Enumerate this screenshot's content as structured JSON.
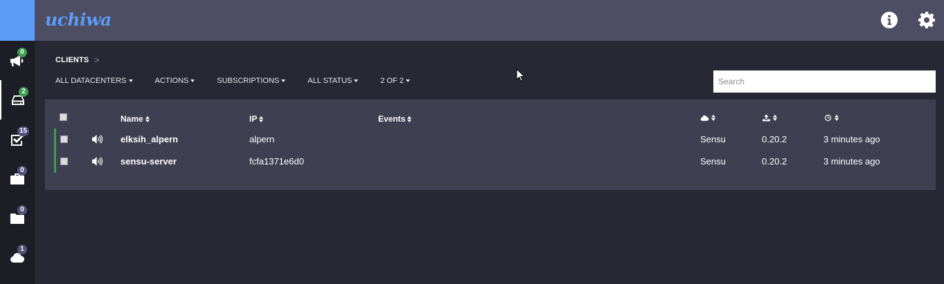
{
  "app": {
    "brand": "uchiwa"
  },
  "colors": {
    "accent": "#5c9bf7",
    "ok": "#3e9c52",
    "badge": "#54507a"
  },
  "sidebar": {
    "items": [
      {
        "icon": "megaphone-icon",
        "label": "Events",
        "badge": "0",
        "badge_color": "green"
      },
      {
        "icon": "server-icon",
        "label": "Clients",
        "badge": "2",
        "badge_color": "green",
        "active": true
      },
      {
        "icon": "check-square-icon",
        "label": "Checks",
        "badge": "15",
        "badge_color": "purple"
      },
      {
        "icon": "briefcase-icon",
        "label": "Stashes",
        "badge": "0",
        "badge_color": "purple"
      },
      {
        "icon": "folder-icon",
        "label": "Aggregates",
        "badge": "0",
        "badge_color": "purple"
      },
      {
        "icon": "cloud-icon",
        "label": "Datacenters",
        "badge": "1",
        "badge_color": "purple"
      }
    ]
  },
  "topbar": {
    "info_icon": "info-icon",
    "settings_icon": "gear-icon"
  },
  "breadcrumb": {
    "current": "CLIENTS",
    "separator": ">"
  },
  "filters": [
    {
      "label": "ALL DATACENTERS"
    },
    {
      "label": "ACTIONS"
    },
    {
      "label": "SUBSCRIPTIONS"
    },
    {
      "label": "ALL STATUS"
    },
    {
      "label": "2 OF 2"
    }
  ],
  "search": {
    "placeholder": "Search",
    "value": ""
  },
  "table": {
    "columns": {
      "name": "Name",
      "ip": "IP",
      "events": "Events"
    },
    "rows": [
      {
        "name": "elksih_alpern",
        "ip": "alpern",
        "events": "",
        "datacenter": "Sensu",
        "version": "0.20.2",
        "last_check": "3 minutes ago"
      },
      {
        "name": "sensu-server",
        "ip": "fcfa1371e6d0",
        "events": "",
        "datacenter": "Sensu",
        "version": "0.20.2",
        "last_check": "3 minutes ago"
      }
    ]
  }
}
